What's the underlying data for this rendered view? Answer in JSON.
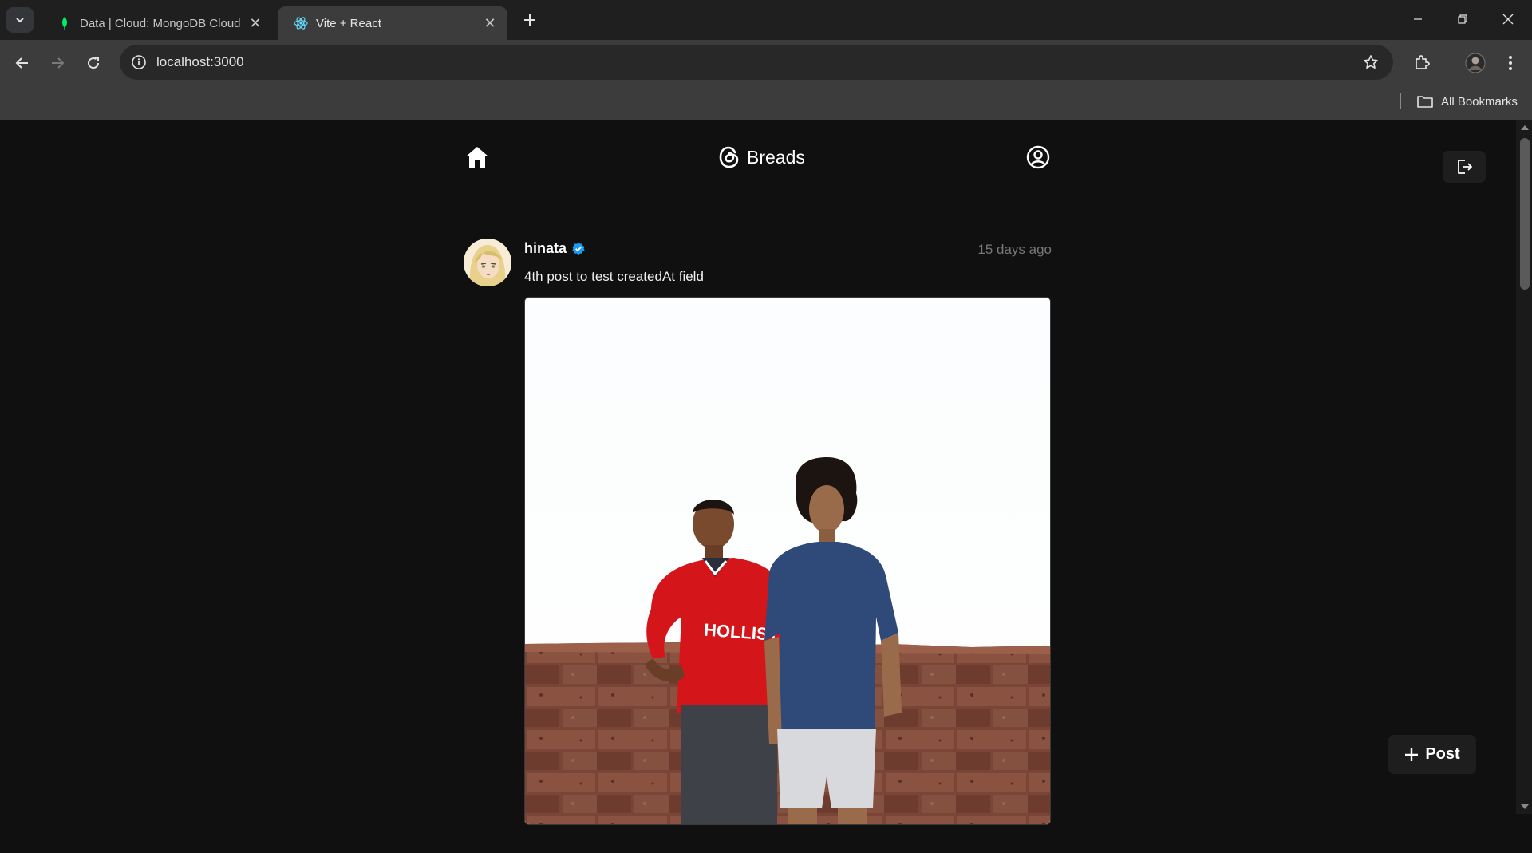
{
  "browser": {
    "tabs": [
      {
        "title": "Data | Cloud: MongoDB Cloud",
        "icon": "mongodb-leaf-icon",
        "active": false
      },
      {
        "title": "Vite + React",
        "icon": "react-icon",
        "active": true
      }
    ],
    "address": "localhost:3000",
    "bookmarks_label": "All Bookmarks"
  },
  "app": {
    "brand": "Breads",
    "post": {
      "username": "hinata",
      "verified": true,
      "time": "15 days ago",
      "text": "4th post to test createdAt field",
      "image_shirt_text": "HOLLISTER"
    },
    "post_button_label": "Post"
  },
  "colors": {
    "page_bg": "#101010",
    "chrome_bg": "#1f1f1f",
    "toolbar_bg": "#3c3c3c",
    "verified_badge": "#1d9bf0",
    "muted_text": "#777777"
  }
}
